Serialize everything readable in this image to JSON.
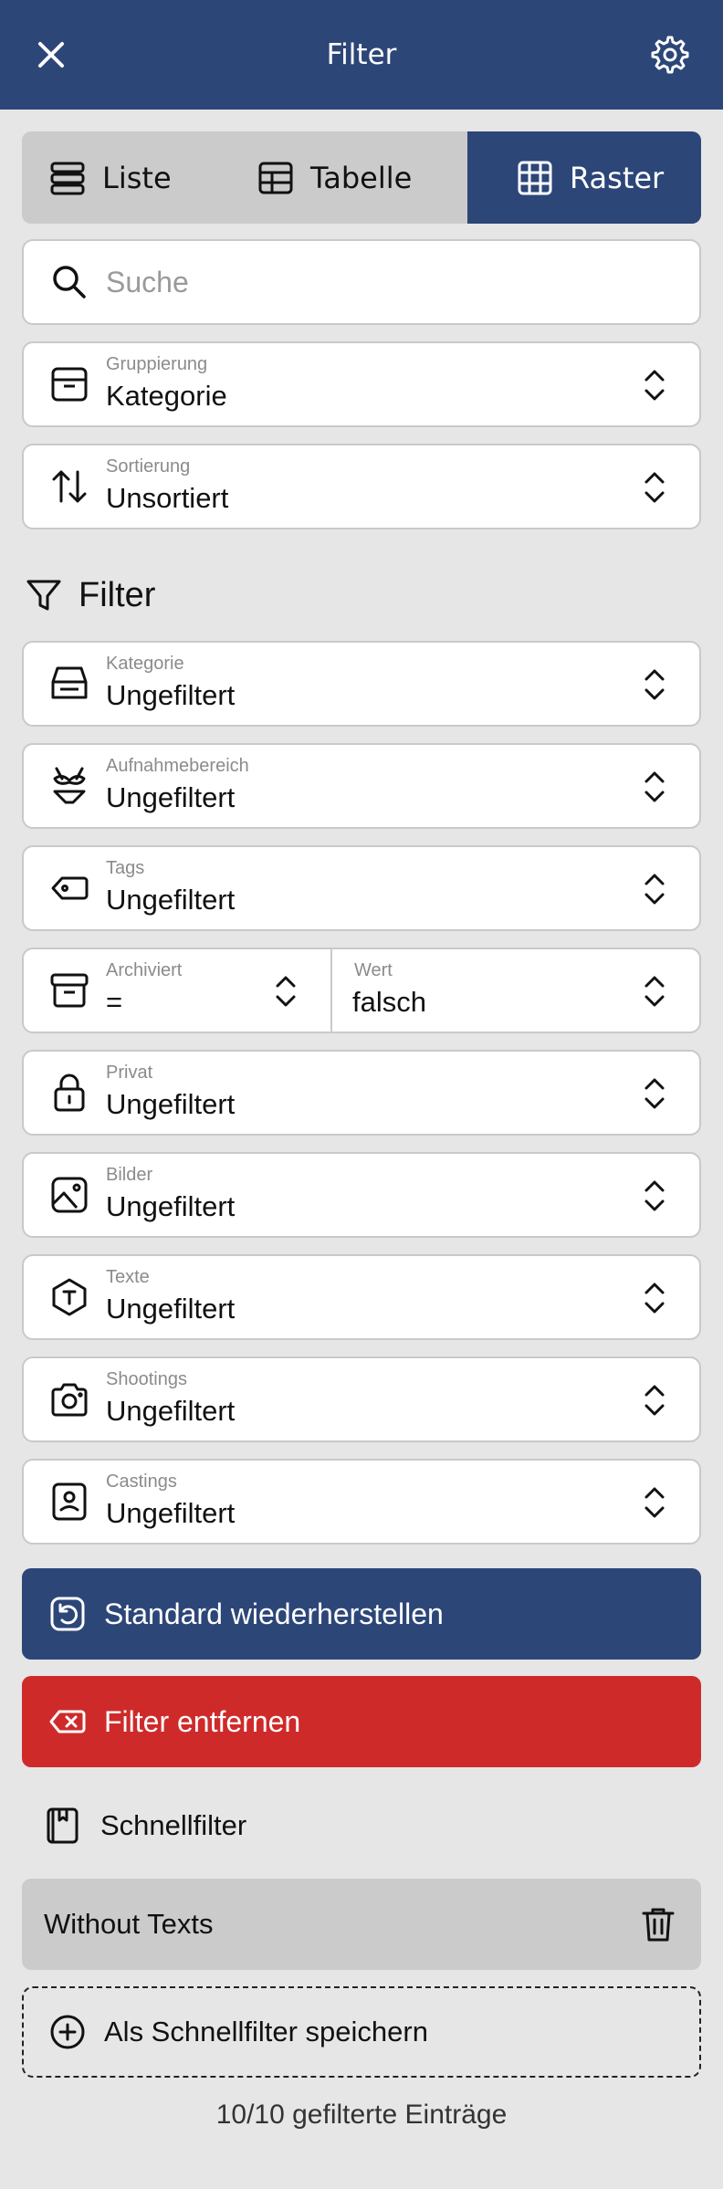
{
  "header": {
    "title": "Filter"
  },
  "view_modes": [
    {
      "label": "Liste",
      "icon": "list-icon"
    },
    {
      "label": "Tabelle",
      "icon": "table-icon"
    },
    {
      "label": "Raster",
      "icon": "grid-icon",
      "selected": true
    }
  ],
  "search": {
    "placeholder": "Suche"
  },
  "grouping": {
    "label": "Gruppierung",
    "value": "Kategorie"
  },
  "sorting": {
    "label": "Sortierung",
    "value": "Unsortiert"
  },
  "filter_section": {
    "title": "Filter"
  },
  "filters": {
    "kategorie": {
      "label": "Kategorie",
      "value": "Ungefiltert"
    },
    "aufnahmebereich": {
      "label": "Aufnahmebereich",
      "value": "Ungefiltert"
    },
    "tags": {
      "label": "Tags",
      "value": "Ungefiltert"
    },
    "archiviert": {
      "label": "Archiviert",
      "operator": "=",
      "value_label": "Wert",
      "value": "falsch"
    },
    "privat": {
      "label": "Privat",
      "value": "Ungefiltert"
    },
    "bilder": {
      "label": "Bilder",
      "value": "Ungefiltert"
    },
    "texte": {
      "label": "Texte",
      "value": "Ungefiltert"
    },
    "shootings": {
      "label": "Shootings",
      "value": "Ungefiltert"
    },
    "castings": {
      "label": "Castings",
      "value": "Ungefiltert"
    }
  },
  "buttons": {
    "restore": "Standard wiederherstellen",
    "remove": "Filter entfernen"
  },
  "quick_filter": {
    "title": "Schnellfilter",
    "items": [
      {
        "name": "Without Texts"
      }
    ],
    "save_label": "Als Schnellfilter speichern"
  },
  "footer": {
    "status": "10/10 gefilterte Einträge"
  },
  "colors": {
    "primary": "#2d4678",
    "danger": "#cf2a2a",
    "background": "#e6e6e6",
    "segment": "#cbcbcb"
  }
}
